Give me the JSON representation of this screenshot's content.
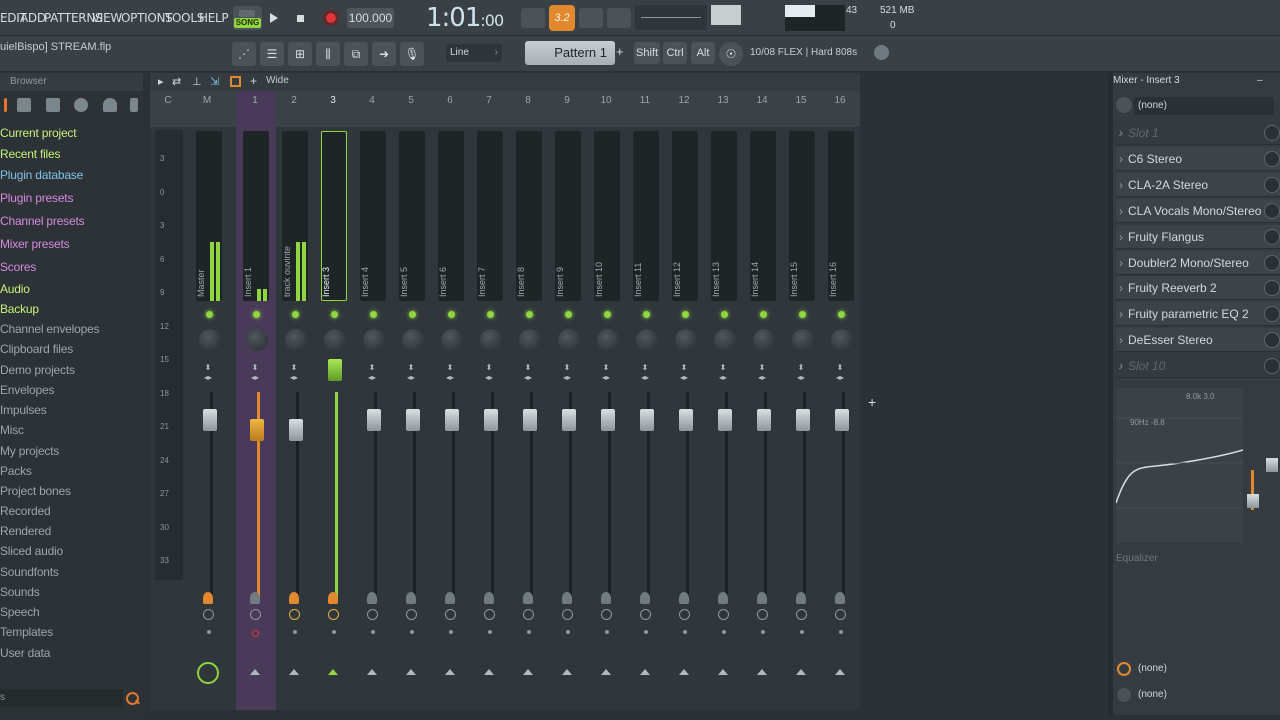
{
  "menu": {
    "items": [
      "EDIT",
      "ADD",
      "PATTERNS",
      "VIEW",
      "OPTIONS",
      "TOOLS",
      "HELP"
    ]
  },
  "transport": {
    "song_label": "SONG",
    "tempo": "100.000",
    "time_main": "1:01",
    "time_sub": ":00",
    "metronome_label": "3.2",
    "cpu": "43",
    "memory": "521 MB",
    "voices": "0"
  },
  "project": {
    "name": "uielBispo] STREAM.flp"
  },
  "toolbar": {
    "snap": "Line",
    "pattern": "Pattern 1",
    "pattern_add": "+",
    "shift": "Shift",
    "ctrl": "Ctrl",
    "alt": "Alt",
    "hint": "10/08  FLEX | Hard 808s"
  },
  "browser": {
    "title": "Browser",
    "items": [
      {
        "label": "Current project",
        "color": "#c8f07c"
      },
      {
        "label": "Recent files",
        "color": "#c8f07c"
      },
      {
        "label": "Plugin database",
        "color": "#7fc4e8"
      },
      {
        "label": "Plugin presets",
        "color": "#d78ae0"
      },
      {
        "label": "Channel presets",
        "color": "#d78ae0"
      },
      {
        "label": "Mixer presets",
        "color": "#d78ae0"
      },
      {
        "label": "Scores",
        "color": "#d78ae0"
      },
      {
        "label": "Audio",
        "color": "#c8f07c"
      },
      {
        "label": "Backup",
        "color": "#c8f07c"
      },
      {
        "label": "Channel envelopes",
        "color": "#9aa6ac"
      },
      {
        "label": "Clipboard files",
        "color": "#9aa6ac"
      },
      {
        "label": "Demo projects",
        "color": "#9aa6ac"
      },
      {
        "label": "Envelopes",
        "color": "#9aa6ac"
      },
      {
        "label": "Impulses",
        "color": "#9aa6ac"
      },
      {
        "label": "Misc",
        "color": "#9aa6ac"
      },
      {
        "label": "My projects",
        "color": "#9aa6ac"
      },
      {
        "label": "Packs",
        "color": "#9aa6ac"
      },
      {
        "label": "Project bones",
        "color": "#9aa6ac"
      },
      {
        "label": "Recorded",
        "color": "#9aa6ac"
      },
      {
        "label": "Rendered",
        "color": "#9aa6ac"
      },
      {
        "label": "Sliced audio",
        "color": "#9aa6ac"
      },
      {
        "label": "Soundfonts",
        "color": "#9aa6ac"
      },
      {
        "label": "Sounds",
        "color": "#9aa6ac"
      },
      {
        "label": "Speech",
        "color": "#9aa6ac"
      },
      {
        "label": "Templates",
        "color": "#9aa6ac"
      },
      {
        "label": "User data",
        "color": "#9aa6ac"
      }
    ],
    "search_value": "s"
  },
  "mixer": {
    "view_mode": "Wide",
    "ruler": [
      "C",
      "M",
      "1",
      "2",
      "3",
      "4",
      "5",
      "6",
      "7",
      "8",
      "9",
      "10",
      "11",
      "12",
      "13",
      "14",
      "15",
      "16"
    ],
    "db_labels": [
      "3",
      "0",
      "3",
      "6",
      "9",
      "12",
      "15",
      "18",
      "21",
      "24",
      "27",
      "30",
      "33"
    ],
    "strips": [
      {
        "name": "Master",
        "active": true,
        "level": 0.35
      },
      {
        "name": "Insert 1",
        "active": true,
        "level": 0.07
      },
      {
        "name": "track ouvinte",
        "active": true,
        "level": 0.35
      },
      {
        "name": "Insert 3",
        "active": true,
        "level": 0.0
      },
      {
        "name": "Insert 4",
        "active": true,
        "level": 0.0
      },
      {
        "name": "Insert 5",
        "active": true,
        "level": 0.0
      },
      {
        "name": "Insert 6",
        "active": true,
        "level": 0.0
      },
      {
        "name": "Insert 7",
        "active": true,
        "level": 0.0
      },
      {
        "name": "Insert 8",
        "active": true,
        "level": 0.0
      },
      {
        "name": "Insert 9",
        "active": true,
        "level": 0.0
      },
      {
        "name": "Insert 10",
        "active": true,
        "level": 0.0
      },
      {
        "name": "Insert 11",
        "active": true,
        "level": 0.0
      },
      {
        "name": "Insert 12",
        "active": true,
        "level": 0.0
      },
      {
        "name": "Insert 13",
        "active": true,
        "level": 0.0
      },
      {
        "name": "Insert 14",
        "active": true,
        "level": 0.0
      },
      {
        "name": "Insert 15",
        "active": true,
        "level": 0.0
      },
      {
        "name": "Insert 16",
        "active": true,
        "level": 0.0
      }
    ]
  },
  "mixer_panel": {
    "title": "Mixer - Insert 3",
    "input": "(none)",
    "slots": [
      {
        "label": "Slot 1",
        "empty": true
      },
      {
        "label": "C6 Stereo",
        "empty": false
      },
      {
        "label": "CLA-2A Stereo",
        "empty": false
      },
      {
        "label": "CLA Vocals Mono/Stereo",
        "empty": false
      },
      {
        "label": "Fruity Flangus",
        "empty": false
      },
      {
        "label": "Doubler2 Mono/Stereo",
        "empty": false
      },
      {
        "label": "Fruity Reeverb 2",
        "empty": false
      },
      {
        "label": "Fruity parametric EQ 2",
        "empty": false
      },
      {
        "label": "DeEsser Stereo",
        "empty": false
      },
      {
        "label": "Slot 10",
        "empty": true
      }
    ],
    "eq_label": "Equalizer",
    "eq_freq1": "90Hz -8.8",
    "eq_freq2": "8.0k 3.0",
    "output1": "(none)",
    "output2": "(none)"
  },
  "colors": {
    "accent_green": "#8fd641",
    "accent_orange": "#e2882f",
    "record_red": "#e1353a",
    "insert1_highlight": "#4a3a5a"
  }
}
